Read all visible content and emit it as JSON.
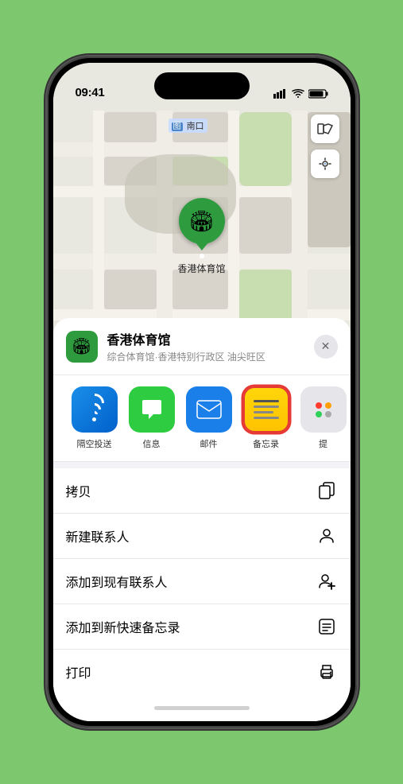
{
  "status": {
    "time": "09:41",
    "signal_bars": "▌▌▌",
    "wifi": "wifi",
    "battery": "battery"
  },
  "map": {
    "label": "南口",
    "layer_indicator": "图"
  },
  "venue": {
    "name": "香港体育馆",
    "pin_label": "香港体育馆",
    "subtitle": "综合体育馆·香港特别行政区 油尖旺区",
    "close_label": "×"
  },
  "share_items": [
    {
      "id": "airdrop",
      "label": "隔空投送",
      "type": "airdrop"
    },
    {
      "id": "messages",
      "label": "信息",
      "type": "messages"
    },
    {
      "id": "mail",
      "label": "邮件",
      "type": "mail"
    },
    {
      "id": "notes",
      "label": "备忘录",
      "type": "notes"
    },
    {
      "id": "more",
      "label": "提",
      "type": "more"
    }
  ],
  "actions": [
    {
      "id": "copy",
      "label": "拷贝",
      "icon": "copy"
    },
    {
      "id": "new-contact",
      "label": "新建联系人",
      "icon": "person"
    },
    {
      "id": "add-existing",
      "label": "添加到现有联系人",
      "icon": "person-add"
    },
    {
      "id": "add-notes",
      "label": "添加到新快速备忘录",
      "icon": "notes"
    },
    {
      "id": "print",
      "label": "打印",
      "icon": "print"
    }
  ]
}
